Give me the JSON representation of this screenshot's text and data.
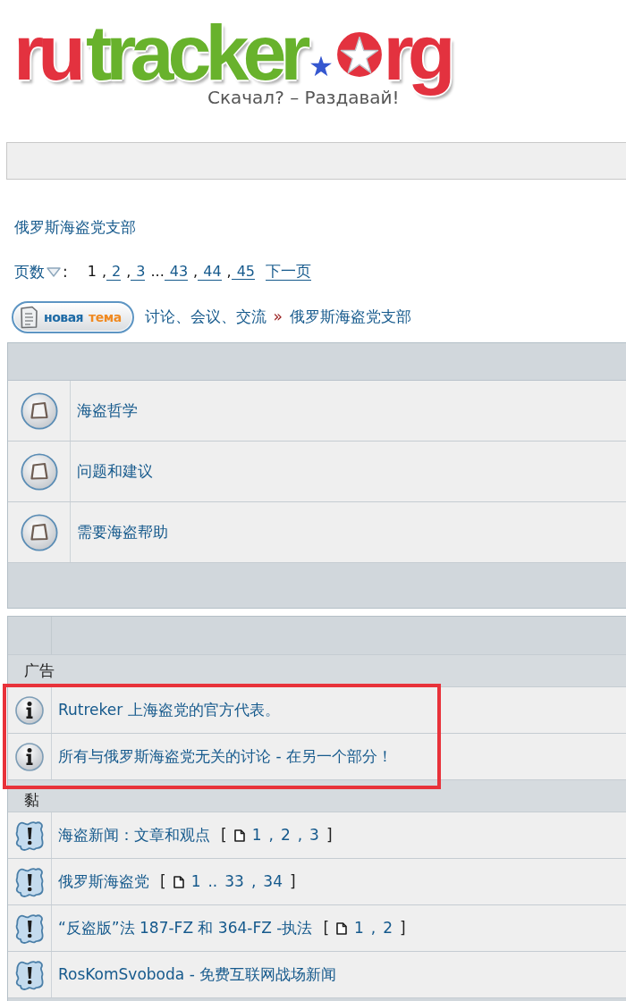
{
  "logo": {
    "segments": [
      {
        "kind": "text",
        "text": "ru",
        "color": "#e3323f"
      },
      {
        "kind": "text",
        "text": "tracker",
        "color": "#68b22c"
      },
      {
        "kind": "star",
        "color": "#3557d0"
      },
      {
        "kind": "ring",
        "color": "#e3323f"
      },
      {
        "kind": "text",
        "text": "rg",
        "color": "#e3323f"
      }
    ],
    "tagline": "Скачал? – Раздавай!"
  },
  "forum_title": "俄罗斯海盗党支部",
  "pagination": {
    "label": "页数",
    "label_end": ":",
    "items": [
      {
        "label": "1",
        "selected": true,
        "suffix": ","
      },
      {
        "label": "2",
        "selected": false,
        "suffix": ","
      },
      {
        "label": "3",
        "selected": false,
        "suffix": "..."
      },
      {
        "label": "43",
        "selected": false,
        "suffix": ","
      },
      {
        "label": "44",
        "selected": false,
        "suffix": ","
      },
      {
        "label": "45",
        "selected": false
      }
    ],
    "next": "下一页"
  },
  "new_topic_button": {
    "words": [
      {
        "text": "новая",
        "color": "#1d6aa5"
      },
      {
        "text": "тема",
        "color": "#f08a22"
      }
    ]
  },
  "breadcrumb": {
    "items": [
      "讨论、会议、交流",
      "俄罗斯海盗党支部"
    ],
    "separator": "»"
  },
  "subforums": [
    {
      "name": "海盗哲学"
    },
    {
      "name": "问题和建议"
    },
    {
      "name": "需要海盗帮助"
    }
  ],
  "topic_sections": [
    {
      "title": "广告",
      "highlighted": true,
      "topics": [
        {
          "kind": "announcement",
          "title": "Rutreker 上海盗党的官方代表。"
        },
        {
          "kind": "announcement",
          "title": "所有与俄罗斯海盗党无关的讨论 - 在另一个部分！"
        }
      ]
    },
    {
      "title": "黏",
      "highlighted": false,
      "topics": [
        {
          "kind": "sticky",
          "title": "海盗新闻：文章和观点",
          "pages": {
            "open": "[",
            "items": [
              {
                "label": "1",
                "suffix": ","
              },
              {
                "label": "2",
                "suffix": ","
              },
              {
                "label": "3"
              }
            ],
            "close": "]"
          }
        },
        {
          "kind": "sticky",
          "title": "俄罗斯海盗党",
          "pages": {
            "open": "[",
            "items": [
              {
                "label": "1",
                "suffix": ".."
              },
              {
                "label": "33",
                "suffix": ","
              },
              {
                "label": "34"
              }
            ],
            "close": "]"
          }
        },
        {
          "kind": "sticky",
          "title": "“反盗版”法 187-FZ 和 364-FZ -执法",
          "pages": {
            "open": "[",
            "items": [
              {
                "label": "1",
                "suffix": ","
              },
              {
                "label": "2"
              }
            ],
            "close": "]"
          }
        },
        {
          "kind": "sticky",
          "title": "RosKomSvoboda - 免费互联网战场新闻"
        }
      ]
    }
  ]
}
